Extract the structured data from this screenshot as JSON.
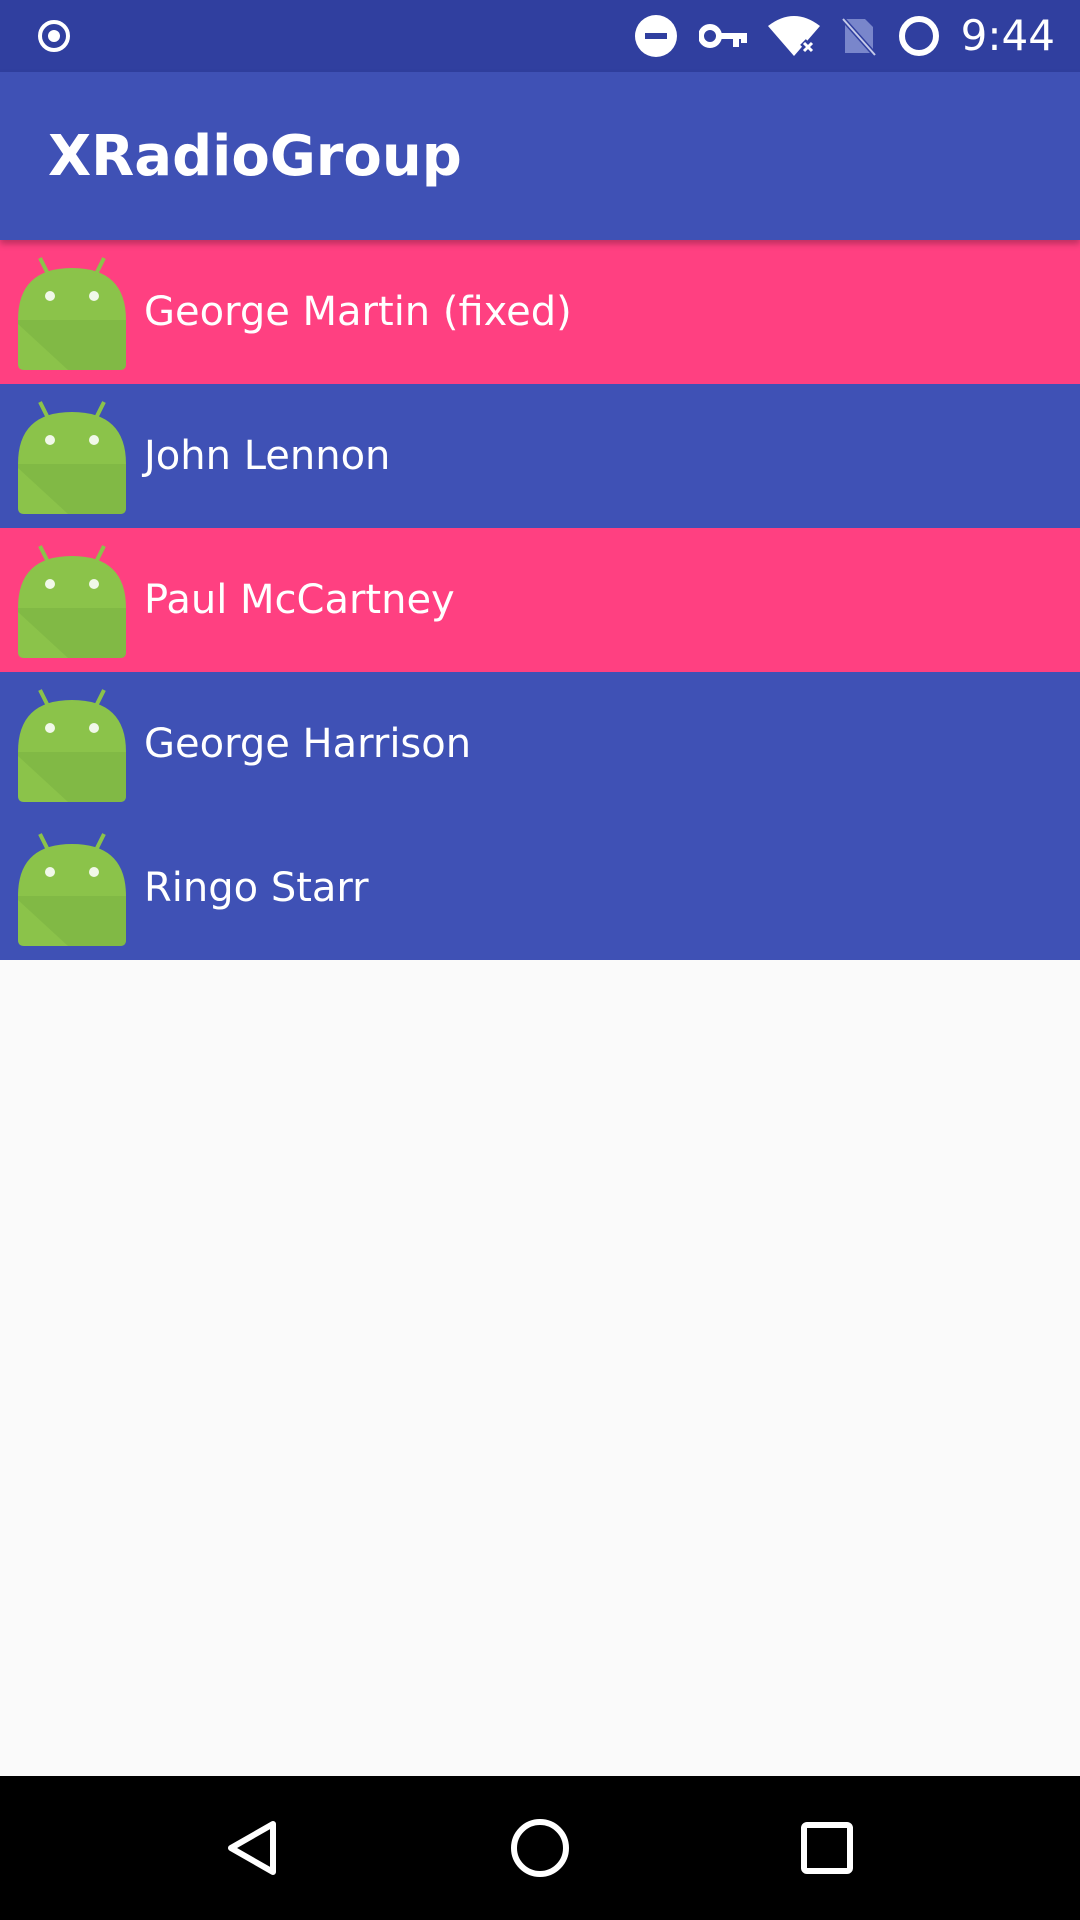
{
  "status_bar": {
    "time": "9:44",
    "icons": [
      "location-target-icon",
      "do-not-disturb-icon",
      "vpn-key-icon",
      "wifi-no-internet-icon",
      "no-sim-icon",
      "sync-circle-icon"
    ]
  },
  "app_bar": {
    "title": "XRadioGroup"
  },
  "list": {
    "items": [
      {
        "label": "George Martin (fixed)",
        "color": "#ff4081",
        "icon": "android-icon"
      },
      {
        "label": "John Lennon",
        "color": "#3f51b5",
        "icon": "android-icon"
      },
      {
        "label": "Paul McCartney",
        "color": "#ff4081",
        "icon": "android-icon"
      },
      {
        "label": "George Harrison",
        "color": "#3f51b5",
        "icon": "android-icon"
      },
      {
        "label": "Ringo Starr",
        "color": "#3f51b5",
        "icon": "android-icon"
      }
    ]
  },
  "nav_bar": {
    "buttons": [
      "back-icon",
      "home-icon",
      "recents-icon"
    ]
  },
  "colors": {
    "primary_dark": "#303f9f",
    "primary": "#3f51b5",
    "accent": "#ff4081",
    "background": "#fafafa"
  }
}
